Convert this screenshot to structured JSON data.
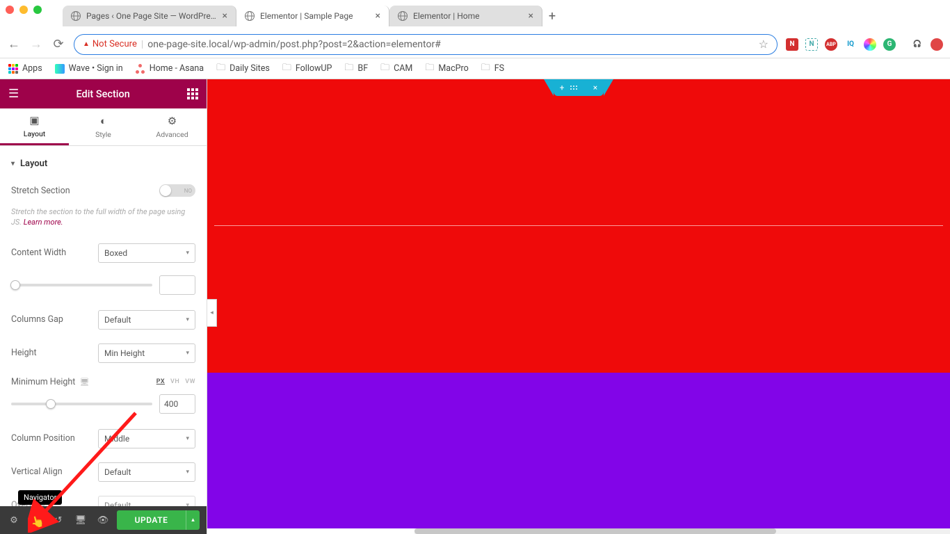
{
  "browser": {
    "tabs": [
      {
        "title": "Pages ‹ One Page Site — WordPress",
        "active": false
      },
      {
        "title": "Elementor | Sample Page",
        "active": true
      },
      {
        "title": "Elementor | Home",
        "active": false
      }
    ],
    "security_label": "Not Secure",
    "url": "one-page-site.local/wp-admin/post.php?post=2&action=elementor#",
    "ext": [
      {
        "bg": "#d32f2f",
        "txt": "N"
      },
      {
        "bg": "#fff",
        "txt": "N",
        "border": "#4aa"
      },
      {
        "bg": "#d32f2f",
        "txt": "ABP"
      },
      {
        "bg": "#fff",
        "txt": "IQ",
        "color": "#19c"
      },
      {
        "bg": "linear-gradient(135deg,#f55,#f5f,#5af)",
        "txt": ""
      },
      {
        "bg": "#2cb673",
        "txt": "G"
      },
      {
        "bg": "#444",
        "txt": "⎋"
      },
      {
        "bg": "#e04646",
        "txt": ""
      }
    ]
  },
  "bookmarks": {
    "apps": "Apps",
    "items": [
      {
        "icon": "wave",
        "label": "Wave • Sign in"
      },
      {
        "icon": "asana",
        "label": "Home - Asana"
      },
      {
        "icon": "folder",
        "label": "Daily Sites"
      },
      {
        "icon": "folder",
        "label": "FollowUP"
      },
      {
        "icon": "folder",
        "label": "BF"
      },
      {
        "icon": "folder",
        "label": "CAM"
      },
      {
        "icon": "folder",
        "label": "MacPro"
      },
      {
        "icon": "folder",
        "label": "FS"
      }
    ]
  },
  "panel": {
    "title": "Edit Section",
    "tabs": {
      "layout": "Layout",
      "style": "Style",
      "advanced": "Advanced"
    },
    "section_label": "Layout",
    "stretch": {
      "label": "Stretch Section",
      "value": "NO"
    },
    "stretch_desc": "Stretch the section to the full width of the page using JS. ",
    "stretch_link": "Learn more.",
    "content_width": {
      "label": "Content Width",
      "value": "Boxed"
    },
    "columns_gap": {
      "label": "Columns Gap",
      "value": "Default"
    },
    "height": {
      "label": "Height",
      "value": "Min Height"
    },
    "min_height": {
      "label": "Minimum Height",
      "units": [
        "PX",
        "VH",
        "VW"
      ],
      "value": "400"
    },
    "column_position": {
      "label": "Column Position",
      "value": "Middle"
    },
    "vertical_align": {
      "label": "Vertical Align",
      "value": "Default"
    },
    "overflow": {
      "label": "Overflow",
      "value": "Default"
    }
  },
  "footer": {
    "tooltip": "Navigator",
    "update": "UPDATE"
  },
  "canvas": {
    "colors": {
      "section1": "#ef0a0a",
      "section2": "#8205e8",
      "handle": "#18b1d4"
    }
  }
}
